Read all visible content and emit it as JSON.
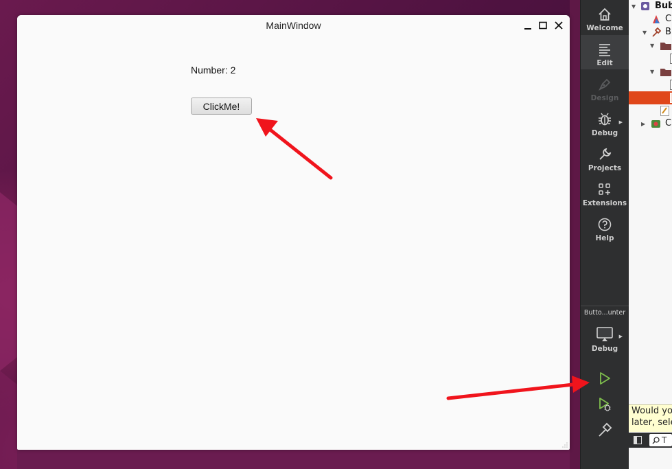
{
  "window": {
    "title": "MainWindow",
    "number_label": "Number: 2",
    "button_label": "ClickMe!"
  },
  "sidebar": {
    "modes": [
      {
        "label": "Welcome",
        "icon": "home-icon"
      },
      {
        "label": "Edit",
        "icon": "edit-icon",
        "active": true
      },
      {
        "label": "Design",
        "icon": "design-pen-icon",
        "disabled": true
      },
      {
        "label": "Debug",
        "icon": "bug-icon"
      },
      {
        "label": "Projects",
        "icon": "wrench-icon"
      },
      {
        "label": "Extensions",
        "icon": "extensions-grid-icon"
      },
      {
        "label": "Help",
        "icon": "help-icon"
      }
    ],
    "kit_name": "Butto...unter",
    "build_config_label": "Debug",
    "actions": [
      "run-icon",
      "debug-run-icon",
      "build-hammer-icon"
    ]
  },
  "tree": {
    "rows": [
      "Bub",
      "C",
      "B",
      "C"
    ],
    "tooltip_line1": "Would yo",
    "tooltip_line2": "later, sele",
    "search_text": "T"
  },
  "colors": {
    "sidebar_bg": "#2e2f30",
    "run_green": "#7fbf4d",
    "selection_orange": "#e0471a",
    "arrow_red": "#f0141c"
  }
}
